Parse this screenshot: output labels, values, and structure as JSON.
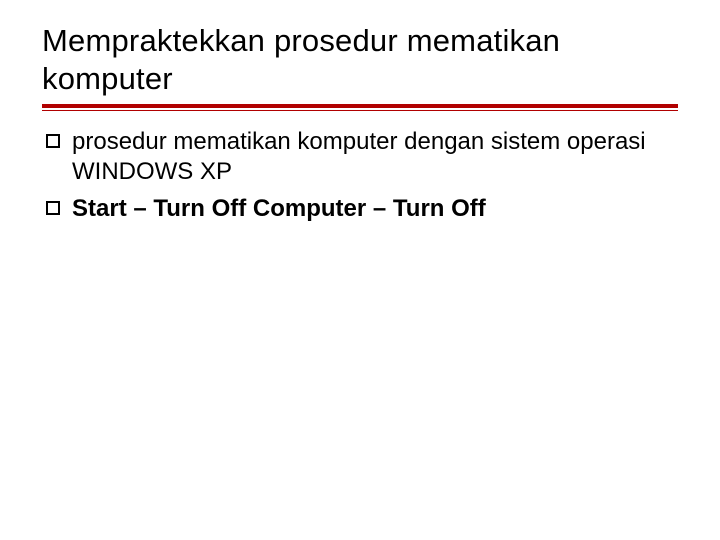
{
  "title": "Mempraktekkan prosedur mematikan komputer",
  "bullets": [
    {
      "text": "prosedur mematikan komputer dengan sistem operasi WINDOWS XP",
      "bold": false
    },
    {
      "text": "Start – Turn Off Computer – Turn Off",
      "bold": true
    }
  ],
  "colors": {
    "accent": "#b10000"
  }
}
